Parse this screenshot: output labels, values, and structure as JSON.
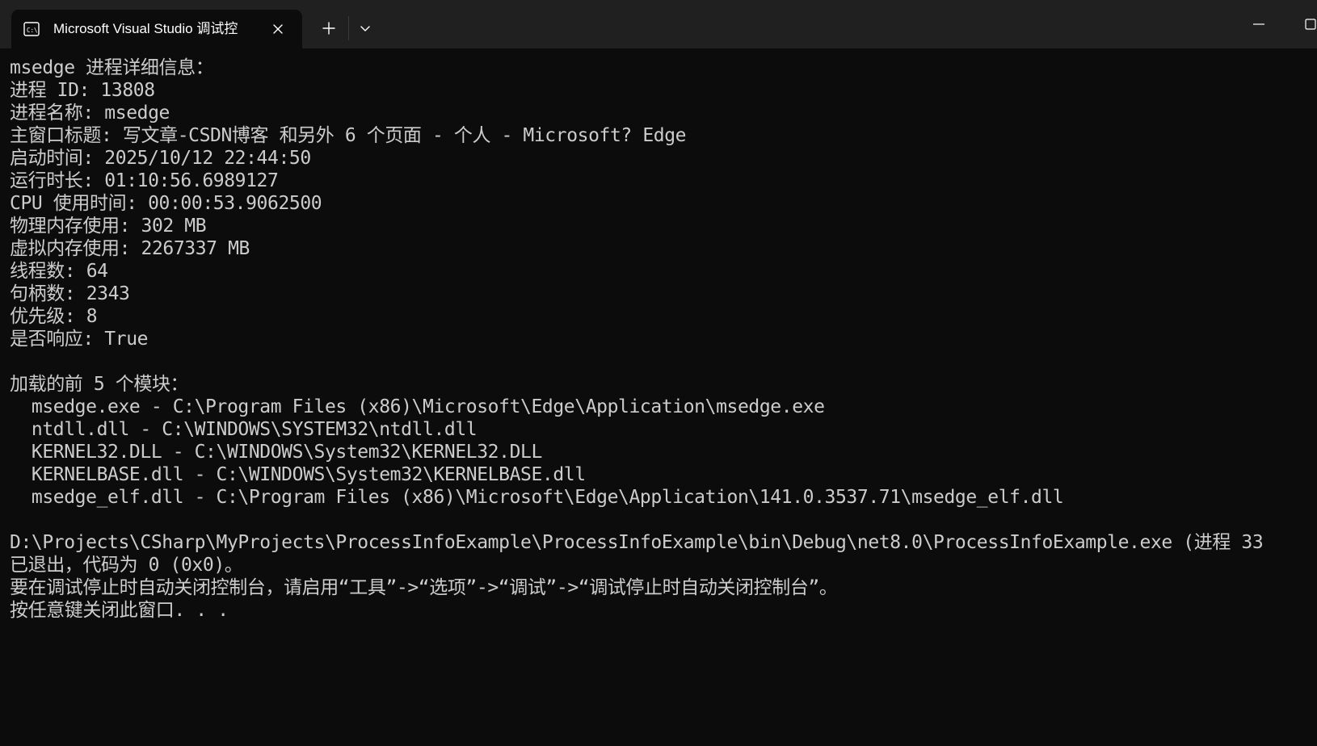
{
  "window": {
    "tab_title": "Microsoft Visual Studio 调试控",
    "icons": {
      "tab": "console-icon",
      "close": "close-icon",
      "new_tab": "plus-icon",
      "dropdown": "chevron-down-icon",
      "minimize": "minimize-icon",
      "maximize": "maximize-icon"
    },
    "colors": {
      "titlebar": "#202020",
      "tab_active": "#0c0c0c",
      "console_background": "#0c0c0c",
      "console_text": "#cccccc"
    }
  },
  "console": {
    "lines": [
      "msedge 进程详细信息：",
      "进程 ID: 13808",
      "进程名称: msedge",
      "主窗口标题: 写文章-CSDN博客 和另外 6 个页面 - 个人 - Microsoft? Edge",
      "启动时间: 2025/10/12 22:44:50",
      "运行时长: 01:10:56.6989127",
      "CPU 使用时间: 00:00:53.9062500",
      "物理内存使用: 302 MB",
      "虚拟内存使用: 2267337 MB",
      "线程数: 64",
      "句柄数: 2343",
      "优先级: 8",
      "是否响应: True",
      "",
      "加载的前 5 个模块：",
      "  msedge.exe - C:\\Program Files (x86)\\Microsoft\\Edge\\Application\\msedge.exe",
      "  ntdll.dll - C:\\WINDOWS\\SYSTEM32\\ntdll.dll",
      "  KERNEL32.DLL - C:\\WINDOWS\\System32\\KERNEL32.DLL",
      "  KERNELBASE.dll - C:\\WINDOWS\\System32\\KERNELBASE.dll",
      "  msedge_elf.dll - C:\\Program Files (x86)\\Microsoft\\Edge\\Application\\141.0.3537.71\\msedge_elf.dll",
      "",
      "D:\\Projects\\CSharp\\MyProjects\\ProcessInfoExample\\ProcessInfoExample\\bin\\Debug\\net8.0\\ProcessInfoExample.exe (进程 33",
      "已退出，代码为 0 (0x0)。",
      "要在调试停止时自动关闭控制台，请启用“工具”->“选项”->“调试”->“调试停止时自动关闭控制台”。",
      "按任意键关闭此窗口. . ."
    ]
  }
}
